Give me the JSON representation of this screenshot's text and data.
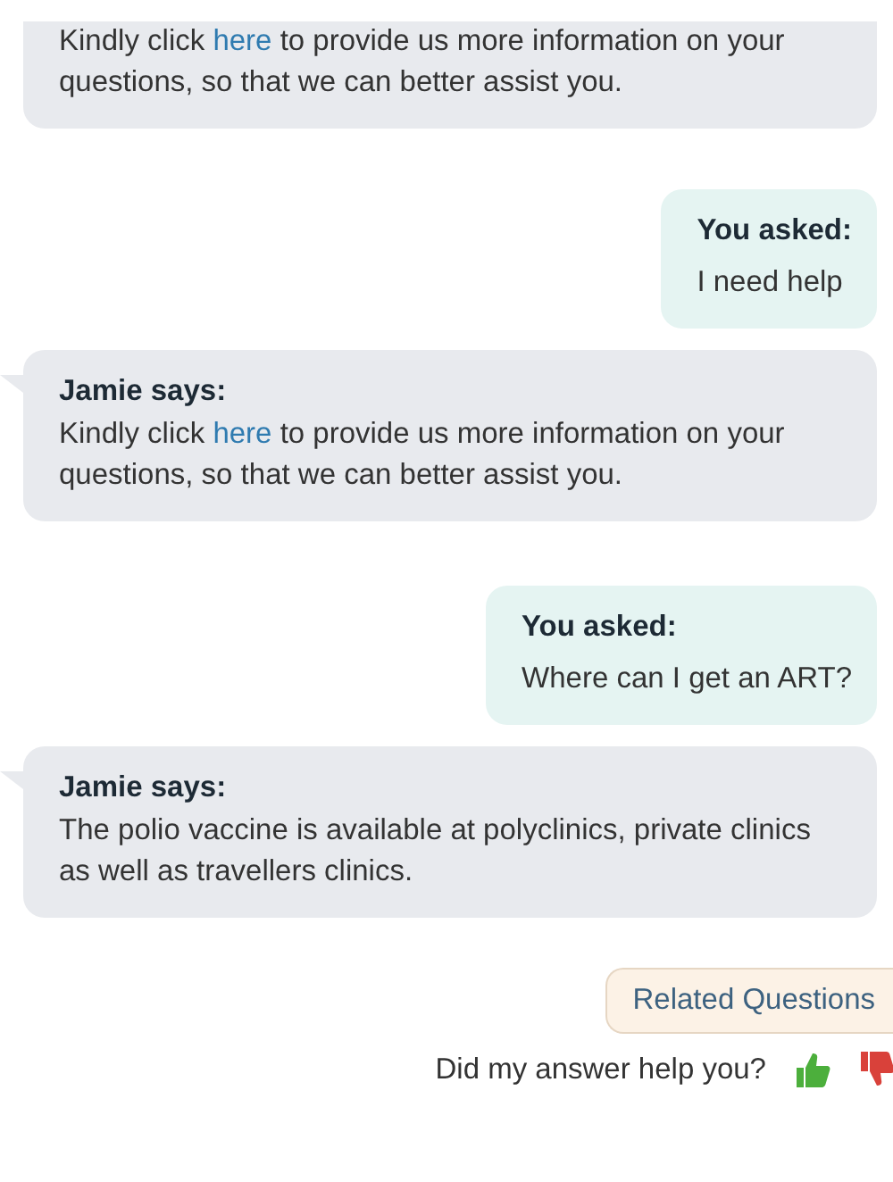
{
  "messages": [
    {
      "kind": "bot",
      "parts": [
        {
          "kind": "text",
          "text": "Kindly click "
        },
        {
          "kind": "link",
          "text": "here"
        },
        {
          "kind": "text",
          "text": " to provide us more information on your questions, so that we can better assist you."
        }
      ]
    },
    {
      "kind": "user",
      "header": "You asked:",
      "parts": [
        {
          "kind": "text",
          "text": "I need help"
        }
      ]
    },
    {
      "kind": "bot",
      "header": "Jamie says:",
      "parts": [
        {
          "kind": "text",
          "text": "Kindly click "
        },
        {
          "kind": "link",
          "text": "here"
        },
        {
          "kind": "text",
          "text": " to provide us more information on your questions, so that we can better assist you."
        }
      ]
    },
    {
      "kind": "user",
      "header": "You asked:",
      "parts": [
        {
          "kind": "text",
          "text": "Where can I get an ART?"
        }
      ]
    },
    {
      "kind": "bot",
      "header": "Jamie says:",
      "parts": [
        {
          "kind": "text",
          "text": "The polio vaccine is available at polyclinics, private clinics as well as travellers clinics."
        }
      ]
    }
  ],
  "related_button": "Related Questions",
  "feedback": {
    "question": "Did my answer help you?"
  }
}
